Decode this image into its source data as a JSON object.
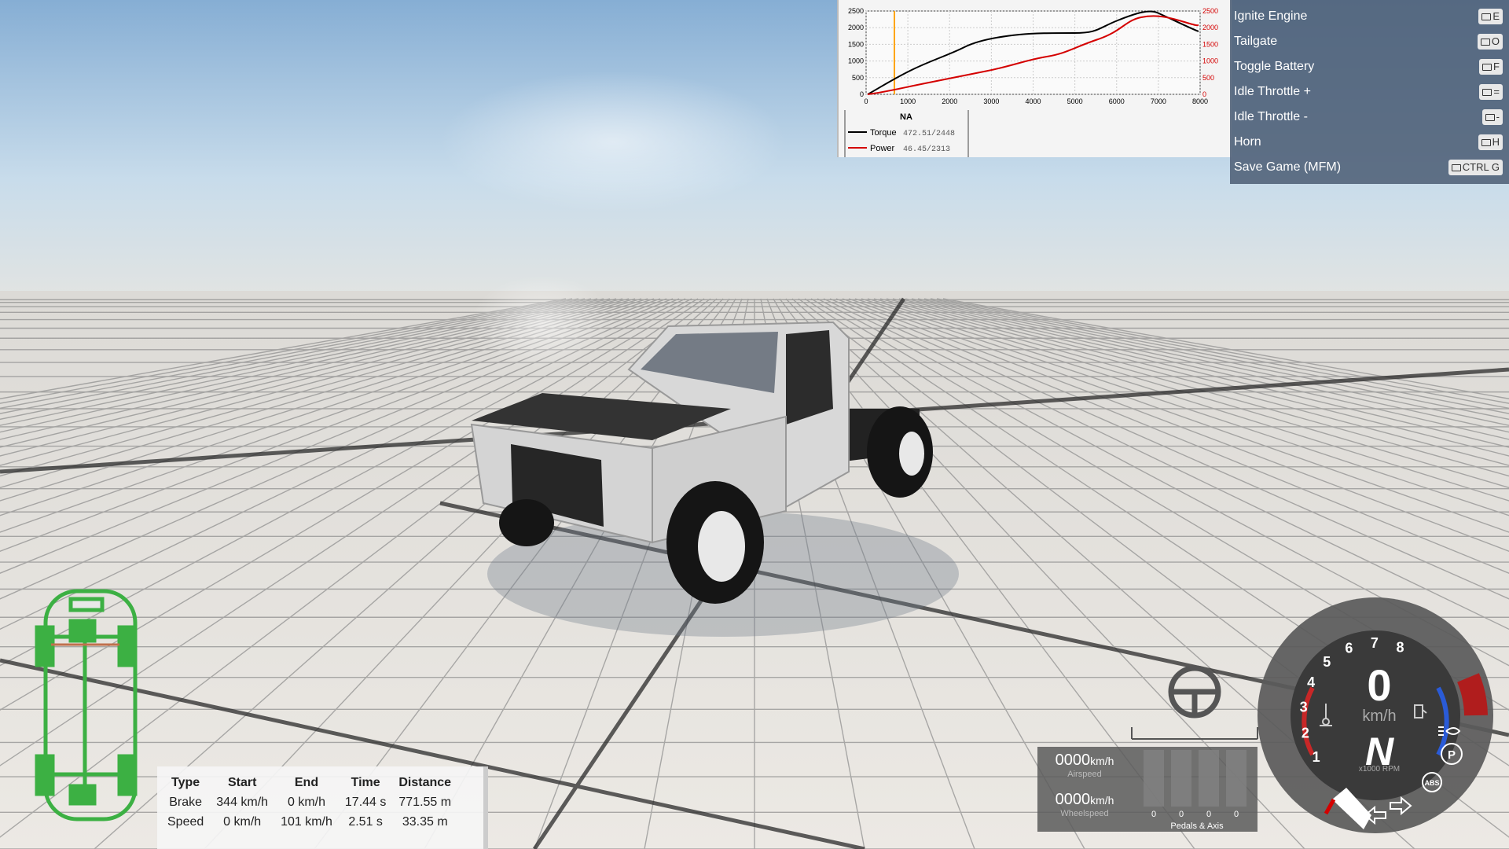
{
  "graph": {
    "left_axis": [
      "2500",
      "2000",
      "1500",
      "1000",
      "500",
      "0"
    ],
    "right_axis": [
      "2500",
      "2000",
      "1500",
      "1000",
      "500",
      "0"
    ],
    "x_axis": [
      "0",
      "1000",
      "2000",
      "3000",
      "4000",
      "5000",
      "6000",
      "7000",
      "8000"
    ],
    "legend_title": "NA",
    "torque_label": "Torque",
    "torque_value": "472.51/2448",
    "power_label": "Power",
    "power_value": "46.45/2313",
    "colors": {
      "torque": "#000000",
      "power": "#d40000",
      "rpm_marker": "#ffa500"
    }
  },
  "bindings": [
    {
      "label": "Ignite Engine",
      "key": "E"
    },
    {
      "label": "Tailgate",
      "key": "O"
    },
    {
      "label": "Toggle Battery",
      "key": "F"
    },
    {
      "label": "Idle Throttle +",
      "key": "="
    },
    {
      "label": "Idle Throttle -",
      "key": "-"
    },
    {
      "label": "Horn",
      "key": "H"
    },
    {
      "label": "Save Game (MFM)",
      "key": "CTRL G"
    }
  ],
  "stats": {
    "headers": [
      "Type",
      "Start",
      "End",
      "Time",
      "Distance"
    ],
    "rows": [
      [
        "Brake",
        "344 km/h",
        "0 km/h",
        "17.44 s",
        "771.55 m"
      ],
      [
        "Speed",
        "0 km/h",
        "101 km/h",
        "2.51 s",
        "33.35 m"
      ]
    ]
  },
  "speed_panel": {
    "airspeed_value": "0000",
    "airspeed_unit": "km/h",
    "airspeed_caption": "Airspeed",
    "wheelspeed_value": "0000",
    "wheelspeed_unit": "km/h",
    "wheelspeed_caption": "Wheelspeed",
    "pedal_values": [
      "0",
      "0",
      "0",
      "0"
    ],
    "pedals_caption": "Pedals & Axis"
  },
  "gauge": {
    "rpm_ticks": [
      "1",
      "2",
      "3",
      "4",
      "5",
      "6",
      "7",
      "8"
    ],
    "speed": "0",
    "speed_unit": "km/h",
    "gear": "N",
    "rpm_unit": "x1000 RPM",
    "parking_label": "P",
    "abs_label": "ABS"
  }
}
